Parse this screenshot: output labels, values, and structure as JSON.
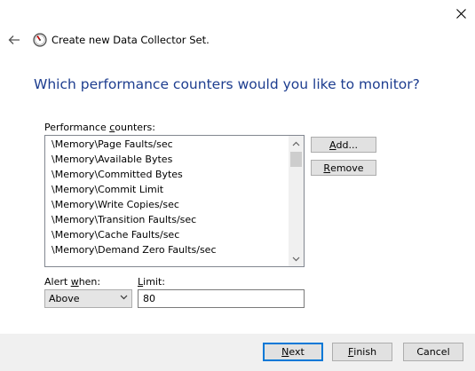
{
  "window": {
    "title": "Create new Data Collector Set.",
    "icons": {
      "close": "close-icon",
      "back": "back-arrow-icon",
      "app": "data-collector-icon"
    }
  },
  "heading": "Which performance counters would you like to monitor?",
  "counters": {
    "label_pre": "Performance ",
    "label_key": "c",
    "label_post": "ounters:",
    "items": [
      "\\Memory\\Page Faults/sec",
      "\\Memory\\Available Bytes",
      "\\Memory\\Committed Bytes",
      "\\Memory\\Commit Limit",
      "\\Memory\\Write Copies/sec",
      "\\Memory\\Transition Faults/sec",
      "\\Memory\\Cache Faults/sec",
      "\\Memory\\Demand Zero Faults/sec"
    ]
  },
  "buttons": {
    "add": {
      "pre": "",
      "key": "A",
      "post": "dd..."
    },
    "remove": {
      "pre": "",
      "key": "R",
      "post": "emove"
    },
    "next": {
      "pre": "",
      "key": "N",
      "post": "ext"
    },
    "finish": {
      "pre": "",
      "key": "F",
      "post": "inish"
    },
    "cancel": "Cancel"
  },
  "alert": {
    "label_pre": "Alert ",
    "label_key": "w",
    "label_post": "hen:",
    "selected": "Above"
  },
  "limit": {
    "label_pre": "",
    "label_key": "L",
    "label_post": "imit:",
    "value": "80"
  },
  "colors": {
    "heading": "#1d3d8f",
    "default_button_border": "#0078d7",
    "footer": "#f0f0f0"
  }
}
